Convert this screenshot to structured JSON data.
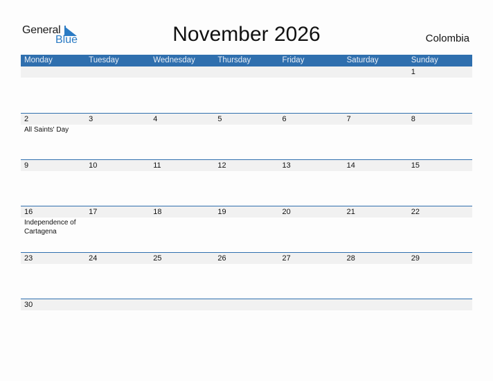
{
  "logo": {
    "general": "General",
    "blue": "Blue"
  },
  "title": "November 2026",
  "country": "Colombia",
  "weekdays": [
    "Monday",
    "Tuesday",
    "Wednesday",
    "Thursday",
    "Friday",
    "Saturday",
    "Sunday"
  ],
  "weeks": [
    {
      "days": [
        "",
        "",
        "",
        "",
        "",
        "",
        "1"
      ],
      "events": [
        "",
        "",
        "",
        "",
        "",
        "",
        ""
      ]
    },
    {
      "days": [
        "2",
        "3",
        "4",
        "5",
        "6",
        "7",
        "8"
      ],
      "events": [
        "All Saints' Day",
        "",
        "",
        "",
        "",
        "",
        ""
      ]
    },
    {
      "days": [
        "9",
        "10",
        "11",
        "12",
        "13",
        "14",
        "15"
      ],
      "events": [
        "",
        "",
        "",
        "",
        "",
        "",
        ""
      ]
    },
    {
      "days": [
        "16",
        "17",
        "18",
        "19",
        "20",
        "21",
        "22"
      ],
      "events": [
        "Independence of Cartagena",
        "",
        "",
        "",
        "",
        "",
        ""
      ]
    },
    {
      "days": [
        "23",
        "24",
        "25",
        "26",
        "27",
        "28",
        "29"
      ],
      "events": [
        "",
        "",
        "",
        "",
        "",
        "",
        ""
      ]
    },
    {
      "days": [
        "30",
        "",
        "",
        "",
        "",
        "",
        ""
      ],
      "events": [
        "",
        "",
        "",
        "",
        "",
        "",
        ""
      ]
    }
  ],
  "colors": {
    "header": "#2f6fae",
    "accent": "#2a7bc4",
    "strip": "#f1f1f1"
  }
}
